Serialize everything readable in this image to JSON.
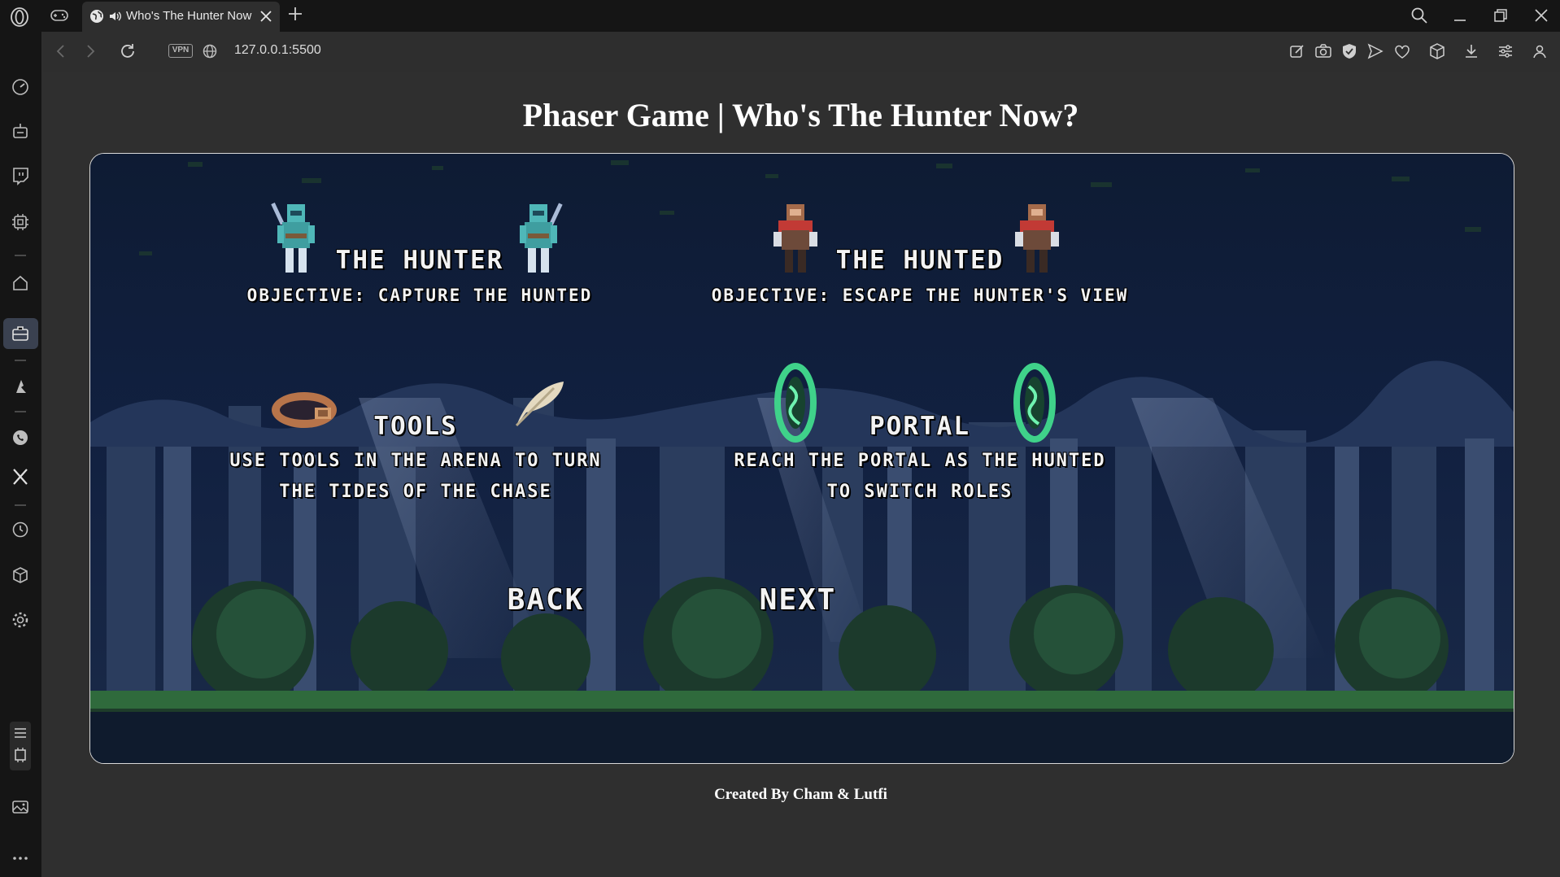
{
  "browser": {
    "tab_title": "Who's The Hunter Now",
    "url": "127.0.0.1:5500",
    "vpn_label": "VPN"
  },
  "page": {
    "title": "Phaser Game | Who's The Hunter Now?",
    "credits": "Created By Cham & Lutfi"
  },
  "game": {
    "hunter": {
      "title": "THE HUNTER",
      "objective": "OBJECTIVE: CAPTURE THE HUNTED"
    },
    "hunted": {
      "title": "THE HUNTED",
      "objective": "OBJECTIVE: ESCAPE THE HUNTER'S VIEW"
    },
    "tools": {
      "title": "TOOLS",
      "line1": "USE TOOLS IN THE ARENA TO TURN",
      "line2": "THE TIDES OF THE CHASE"
    },
    "portal": {
      "title": "PORTAL",
      "line1": "REACH THE PORTAL AS THE HUNTED",
      "line2": "TO SWITCH ROLES"
    },
    "back_label": "BACK",
    "next_label": "NEXT"
  },
  "colors": {
    "hunter_body": "#4fb7b8",
    "hunted_cloak": "#c23a35",
    "portal": "#3fd28a",
    "sky": "#0d1a30"
  }
}
